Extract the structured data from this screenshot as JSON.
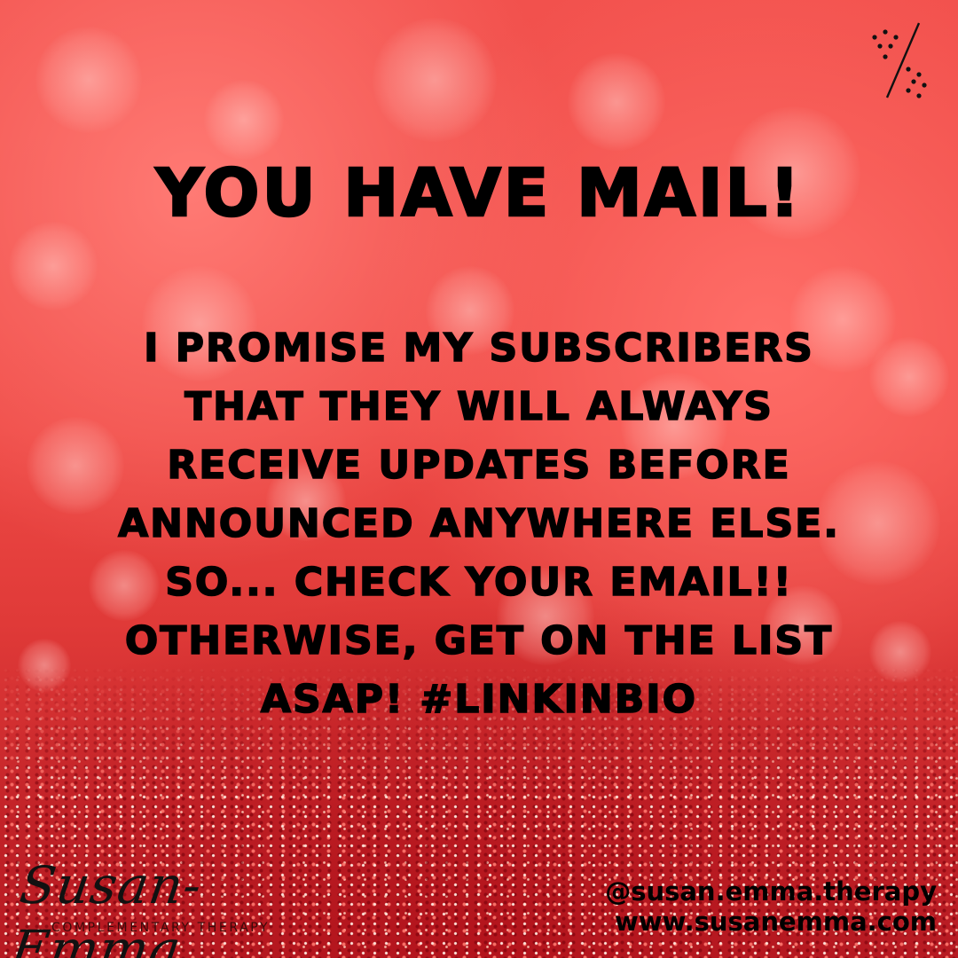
{
  "headline": "YOU HAVE MAIL!",
  "body_lines": [
    "I PROMISE MY SUBSCRIBERS",
    "THAT THEY WILL ALWAYS",
    "RECEIVE UPDATES BEFORE",
    "ANNOUNCED ANYWHERE ELSE.",
    "SO... CHECK YOUR EMAIL!!",
    "OTHERWISE, GET ON THE LIST",
    "ASAP! #LINKINBIO"
  ],
  "logo": {
    "name": "Susan-Emma",
    "tagline": "COMPLEMENTARY THERAPY"
  },
  "contact": {
    "handle": "@susan.emma.therapy",
    "website": "www.susanemma.com"
  },
  "icons": {
    "corner": "percent-dots-icon"
  },
  "colors": {
    "background": "#ee4a46",
    "text": "#000000"
  }
}
